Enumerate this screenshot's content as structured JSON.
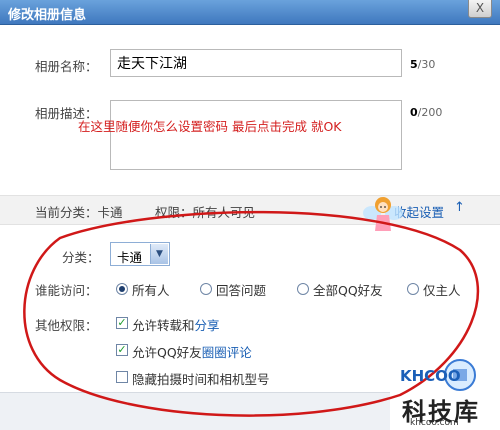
{
  "dialog": {
    "title": "修改相册信息",
    "close_glyph": "X"
  },
  "form": {
    "name_label": "相册名称：",
    "name_value": "走天下江湖",
    "name_count": "5",
    "name_max": "/30",
    "desc_label": "相册描述：",
    "desc_count": "0",
    "desc_max": "/200",
    "desc_hint": "在这里随便你怎么设置密码 最后点击完成 就OK"
  },
  "info_bar": {
    "current_category": "当前分类：卡通",
    "permission": "权限：所有人可见",
    "collapse_label": "收起设置",
    "collapse_arrow": "↑"
  },
  "category": {
    "label": "分类：",
    "selected": "卡通"
  },
  "access": {
    "label": "谁能访问：",
    "options": [
      "所有人",
      "回答问题",
      "全部QQ好友",
      "仅主人"
    ],
    "selected_index": 0
  },
  "other_permissions": {
    "label": "其他权限：",
    "items": [
      {
        "prefix": "允许转载和",
        "link": "分享",
        "checked": true
      },
      {
        "prefix": "允许QQ好友",
        "link": "圈圈评论",
        "checked": true
      },
      {
        "prefix": "隐藏拍摄时间和相机型号",
        "link": "",
        "checked": false
      }
    ]
  },
  "watermark": {
    "logo_text": "KHCOO",
    "brand": "科技库",
    "url": "khcoo.com"
  },
  "colors": {
    "title_bar": "#3f78be",
    "hint_text": "#d42020",
    "annotation_ellipse": "#d01818",
    "link": "#1a5fb4"
  }
}
